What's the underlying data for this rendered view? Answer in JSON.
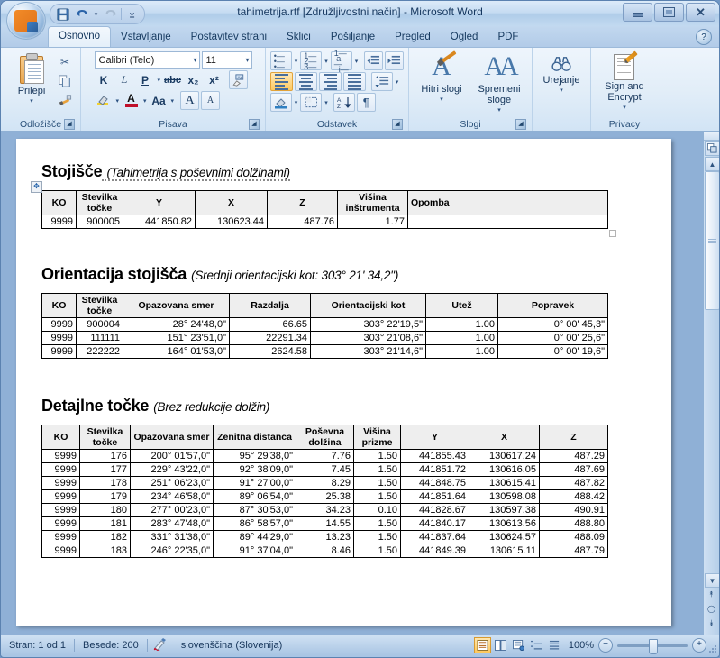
{
  "window": {
    "title": "tahimetrija.rtf [Združljivostni način] - Microsoft Word",
    "minimize_label": "Minimiraj",
    "restore_label": "Obnovi",
    "close_label": "Zapri"
  },
  "quick_access": {
    "save_icon": "save-icon",
    "undo_icon": "undo-icon",
    "redo_icon": "redo-icon",
    "customize_icon": "chevron-down-icon"
  },
  "office_button": {
    "label": "Office",
    "icon": "office-orb-icon"
  },
  "help": {
    "label": "?",
    "icon": "help-icon"
  },
  "tabs": [
    {
      "label": "Osnovno",
      "active": true
    },
    {
      "label": "Vstavljanje",
      "active": false
    },
    {
      "label": "Postavitev strani",
      "active": false
    },
    {
      "label": "Sklici",
      "active": false
    },
    {
      "label": "Pošiljanje",
      "active": false
    },
    {
      "label": "Pregled",
      "active": false
    },
    {
      "label": "Ogled",
      "active": false
    },
    {
      "label": "PDF",
      "active": false
    }
  ],
  "ribbon": {
    "groups": [
      {
        "name": "clipboard",
        "label": "Odložišče"
      },
      {
        "name": "font",
        "label": "Pisava"
      },
      {
        "name": "paragraph",
        "label": "Odstavek"
      },
      {
        "name": "styles",
        "label": "Slogi"
      },
      {
        "name": "editing",
        "label": ""
      },
      {
        "name": "privacy",
        "label": "Privacy"
      }
    ],
    "clipboard": {
      "paste_label": "Prilepi",
      "paste_icon": "paste-icon",
      "cut_icon": "scissors-icon",
      "copy_icon": "copy-icon",
      "format_painter_icon": "format-painter-icon"
    },
    "font": {
      "font_family_value": "Calibri (Telo)",
      "font_size_value": "11",
      "bold_label": "K",
      "italic_label": "L",
      "underline_label": "P",
      "strikethrough_label": "abc",
      "subscript_label": "x₂",
      "superscript_label": "x²",
      "clear_format_icon": "clear-formatting-icon",
      "highlight_icon": "text-highlight-icon",
      "font_color_label": "A",
      "change_case_label": "Aa",
      "grow_font_label": "A",
      "shrink_font_label": "A"
    },
    "paragraph": {
      "bullets_icon": "bullet-list-icon",
      "numbering_icon": "numbered-list-icon",
      "multilevel_icon": "multilevel-list-icon",
      "decrease_indent_icon": "decrease-indent-icon",
      "increase_indent_icon": "increase-indent-icon",
      "align_left_icon": "align-left-icon",
      "align_center_icon": "align-center-icon",
      "align_right_icon": "align-right-icon",
      "justify_icon": "justify-icon",
      "line_spacing_icon": "line-spacing-icon",
      "shading_icon": "shading-icon",
      "borders_icon": "borders-icon",
      "sort_icon": "sort-az-icon",
      "show_marks_label": "¶"
    },
    "styles": {
      "quick_styles_label": "Hitri slogi",
      "change_styles_label": "Spremeni sloge",
      "quick_styles_icon": "quick-styles-icon",
      "change_styles_icon": "change-styles-icon"
    },
    "editing": {
      "label": "Urejanje",
      "icon": "binoculars-icon"
    },
    "privacy": {
      "sign_encrypt_label": "Sign and Encrypt",
      "icon": "sign-document-icon"
    }
  },
  "document": {
    "sections": [
      {
        "title": "Stojišče",
        "subtitle": "(Tahimetrija s poševnimi dolžinami)",
        "columns": [
          "KO",
          "Stevilka točke",
          "Y",
          "X",
          "Z",
          "Višina inštrumenta",
          "Opomba"
        ],
        "rows": [
          [
            "9999",
            "900005",
            "441850.82",
            "130623.44",
            "487.76",
            "1.77",
            ""
          ]
        ]
      },
      {
        "title": "Orientacija stojišča",
        "subtitle": "(Srednji orientacijski kot: 303° 21' 34,2\")",
        "columns": [
          "KO",
          "Stevilka točke",
          "Opazovana smer",
          "Razdalja",
          "Orientacijski kot",
          "Utež",
          "Popravek"
        ],
        "rows": [
          [
            "9999",
            "900004",
            "28° 24'48,0\"",
            "66.65",
            "303° 22'19,5\"",
            "1.00",
            "0° 00' 45,3\""
          ],
          [
            "9999",
            "111111",
            "151° 23'51,0\"",
            "22291.34",
            "303° 21'08,6\"",
            "1.00",
            "0° 00' 25,6\""
          ],
          [
            "9999",
            "222222",
            "164° 01'53,0\"",
            "2624.58",
            "303° 21'14,6\"",
            "1.00",
            "0° 00' 19,6\""
          ]
        ]
      },
      {
        "title": "Detajlne točke",
        "subtitle": "(Brez redukcije dolžin)",
        "columns": [
          "KO",
          "Stevilka točke",
          "Opazovana smer",
          "Zenitna distanca",
          "Poševna dolžina",
          "Višina prizme",
          "Y",
          "X",
          "Z"
        ],
        "rows": [
          [
            "9999",
            "176",
            "200° 01'57,0\"",
            "95° 29'38,0\"",
            "7.76",
            "1.50",
            "441855.43",
            "130617.24",
            "487.29"
          ],
          [
            "9999",
            "177",
            "229° 43'22,0\"",
            "92° 38'09,0\"",
            "7.45",
            "1.50",
            "441851.72",
            "130616.05",
            "487.69"
          ],
          [
            "9999",
            "178",
            "251° 06'23,0\"",
            "91° 27'00,0\"",
            "8.29",
            "1.50",
            "441848.75",
            "130615.41",
            "487.82"
          ],
          [
            "9999",
            "179",
            "234° 46'58,0\"",
            "89° 06'54,0\"",
            "25.38",
            "1.50",
            "441851.64",
            "130598.08",
            "488.42"
          ],
          [
            "9999",
            "180",
            "277° 00'23,0\"",
            "87° 30'53,0\"",
            "34.23",
            "0.10",
            "441828.67",
            "130597.38",
            "490.91"
          ],
          [
            "9999",
            "181",
            "283° 47'48,0\"",
            "86° 58'57,0\"",
            "14.55",
            "1.50",
            "441840.17",
            "130613.56",
            "488.80"
          ],
          [
            "9999",
            "182",
            "331° 31'38,0\"",
            "89° 44'29,0\"",
            "13.23",
            "1.50",
            "441837.64",
            "130624.57",
            "488.09"
          ],
          [
            "9999",
            "183",
            "246° 22'35,0\"",
            "91° 37'04,0\"",
            "8.46",
            "1.50",
            "441849.39",
            "130615.11",
            "487.79"
          ]
        ]
      }
    ]
  },
  "status_bar": {
    "page": "Stran: 1 od 1",
    "words": "Besede: 200",
    "proofing_icon": "proofing-errors-icon",
    "language": "slovenščina (Slovenija)",
    "views": [
      {
        "name": "print-layout",
        "icon": "print-layout-icon",
        "active": true
      },
      {
        "name": "full-screen-reading",
        "icon": "reading-view-icon",
        "active": false
      },
      {
        "name": "web-layout",
        "icon": "web-layout-icon",
        "active": false
      },
      {
        "name": "outline",
        "icon": "outline-view-icon",
        "active": false
      },
      {
        "name": "draft",
        "icon": "draft-view-icon",
        "active": false
      }
    ],
    "zoom_value": "100%",
    "zoom_out_label": "−",
    "zoom_in_label": "+"
  },
  "scrollbar": {
    "select_object_icon": "select-browse-object-icon",
    "up_arrow_icon": "chevron-up-icon",
    "down_arrow_icon": "chevron-down-icon",
    "prev_page_icon": "previous-page-icon",
    "browse_icon": "browse-object-icon",
    "next_page_icon": "next-page-icon"
  }
}
